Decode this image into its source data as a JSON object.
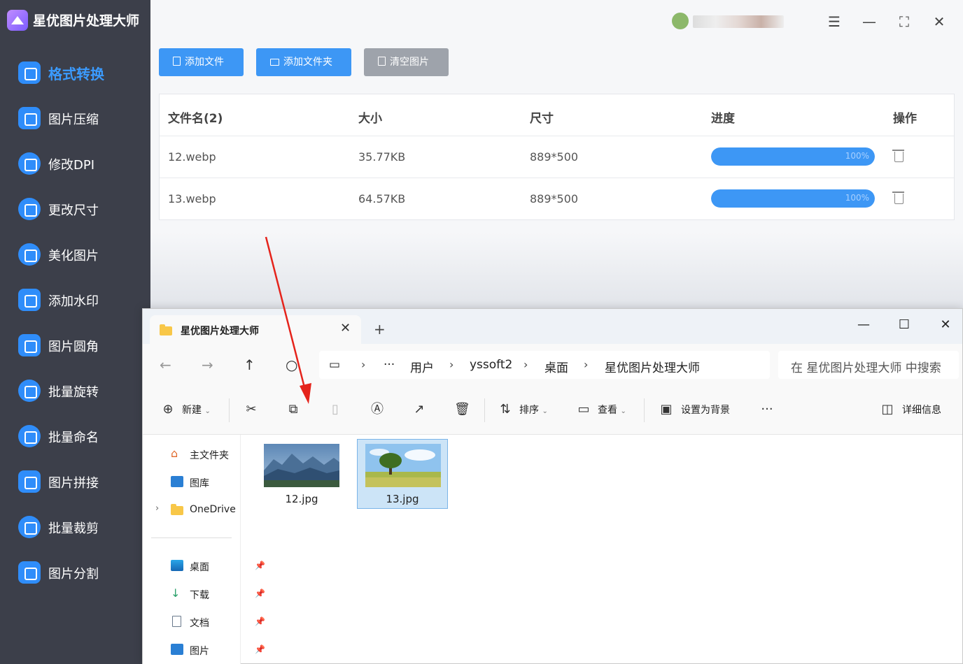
{
  "app": {
    "title": "星优图片处理大师",
    "sidebar": [
      {
        "label": "格式转换",
        "icon": "image-convert-icon",
        "active": true
      },
      {
        "label": "图片压缩",
        "icon": "compress-icon"
      },
      {
        "label": "修改DPI",
        "icon": "dpi-icon"
      },
      {
        "label": "更改尺寸",
        "icon": "resize-icon"
      },
      {
        "label": "美化图片",
        "icon": "beautify-icon"
      },
      {
        "label": "添加水印",
        "icon": "watermark-icon"
      },
      {
        "label": "图片圆角",
        "icon": "round-corner-icon"
      },
      {
        "label": "批量旋转",
        "icon": "rotate-icon"
      },
      {
        "label": "批量命名",
        "icon": "rename-icon"
      },
      {
        "label": "图片拼接",
        "icon": "stitch-icon"
      },
      {
        "label": "批量裁剪",
        "icon": "crop-icon"
      },
      {
        "label": "图片分割",
        "icon": "split-icon"
      }
    ],
    "toolbar": {
      "add_file": "添加文件",
      "add_folder": "添加文件夹",
      "clear": "清空图片"
    },
    "table": {
      "headers": [
        "文件名(2)",
        "大小",
        "尺寸",
        "进度",
        "操作"
      ],
      "rows": [
        {
          "name": "12.webp",
          "size": "35.77KB",
          "dims": "889*500",
          "progress": 100,
          "progress_label": "100%"
        },
        {
          "name": "13.webp",
          "size": "64.57KB",
          "dims": "889*500",
          "progress": 100,
          "progress_label": "100%"
        }
      ]
    },
    "colors": {
      "accent": "#3d97f5",
      "sidebar": "#3c3f4a",
      "clear_button": "#9ea3ab"
    }
  },
  "explorer": {
    "tab_title": "星优图片处理大师",
    "breadcrumb": [
      "用户",
      "yssoft2",
      "桌面",
      "星优图片处理大师"
    ],
    "search_placeholder": "在 星优图片处理大师 中搜索",
    "commands": {
      "new": "新建",
      "sort": "排序",
      "view": "查看",
      "set_background": "设置为背景",
      "details": "详细信息"
    },
    "nav_pane": [
      {
        "label": "主文件夹",
        "icon": "home-icon"
      },
      {
        "label": "图库",
        "icon": "gallery-icon"
      },
      {
        "label": "OneDrive",
        "icon": "folder-icon"
      },
      {
        "label": "桌面",
        "icon": "desktop-icon",
        "pinned": true
      },
      {
        "label": "下载",
        "icon": "download-icon",
        "pinned": true
      },
      {
        "label": "文档",
        "icon": "document-icon",
        "pinned": true
      },
      {
        "label": "图片",
        "icon": "pictures-icon",
        "pinned": true
      }
    ],
    "files": [
      {
        "name": "12.jpg",
        "selected": false
      },
      {
        "name": "13.jpg",
        "selected": true
      }
    ]
  }
}
